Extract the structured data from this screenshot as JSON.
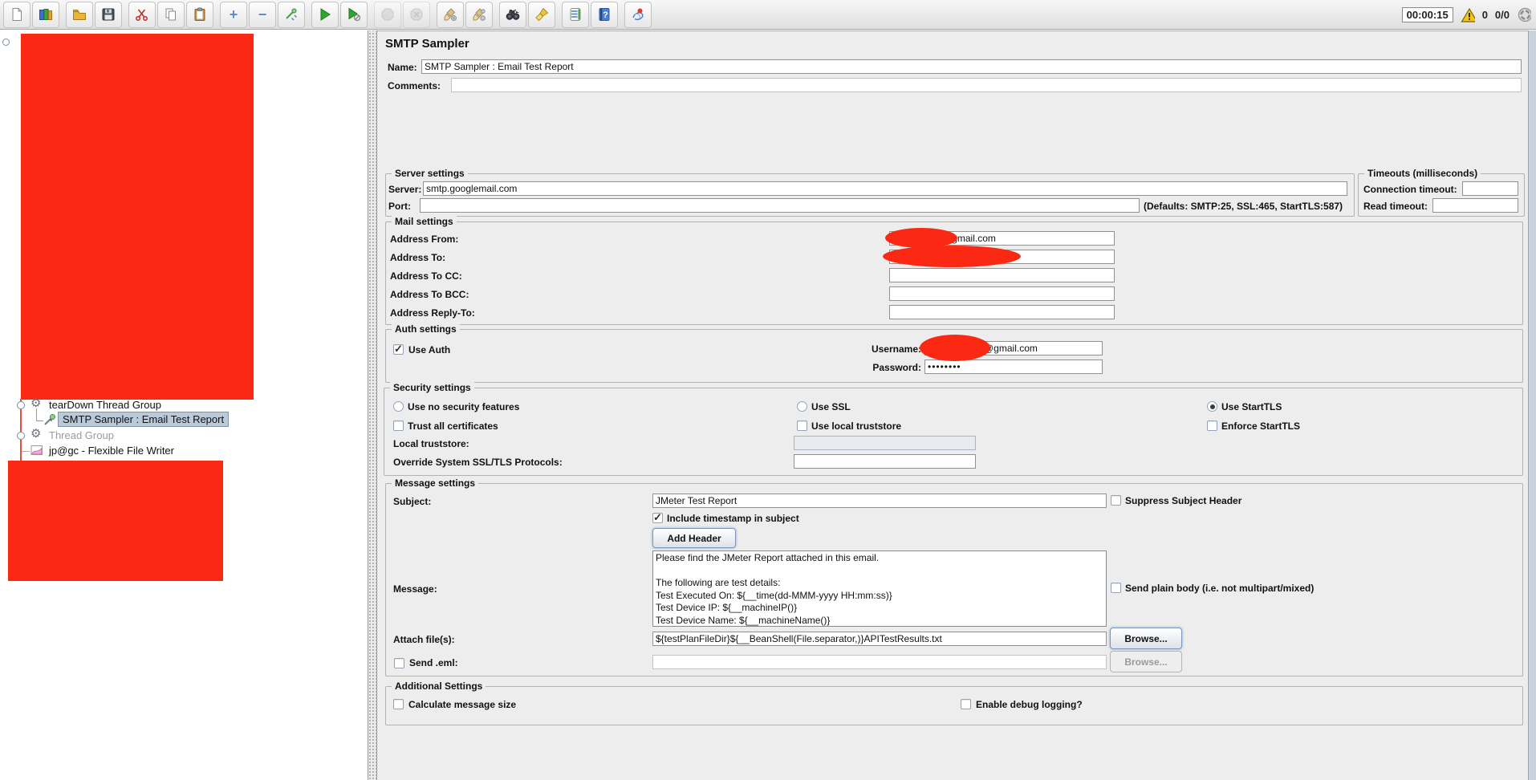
{
  "toolbar": {
    "icons": [
      "new-file",
      "templates",
      "open-file",
      "save",
      "cut",
      "copy",
      "paste",
      "expand-all",
      "collapse-all",
      "toggle",
      "start",
      "start-no-pauses",
      "stop",
      "shutdown",
      "clear",
      "clear-all",
      "search",
      "search-reset",
      "function-helper",
      "help",
      "plugins-manager"
    ],
    "timer": "00:00:15",
    "error_count": "0",
    "thread_status": "0/0"
  },
  "tree": {
    "items": [
      {
        "label": "tearDown Thread Group",
        "type": "thread-group",
        "state": "expanded",
        "selected": false,
        "disabled": false
      },
      {
        "label": "SMTP Sampler : Email Test Report",
        "type": "smtp-sampler",
        "selected": true,
        "disabled": false
      },
      {
        "label": "Thread Group",
        "type": "thread-group",
        "state": "collapsed",
        "selected": false,
        "disabled": true
      },
      {
        "label": "jp@gc - Flexible File Writer",
        "type": "flexible-file-writer",
        "selected": false,
        "disabled": false
      }
    ]
  },
  "main": {
    "title": "SMTP Sampler",
    "name": {
      "label": "Name:",
      "value": "SMTP Sampler : Email Test Report"
    },
    "comments": {
      "label": "Comments:",
      "value": ""
    },
    "server_settings": {
      "legend": "Server settings",
      "server_label": "Server:",
      "server_value": "smtp.googlemail.com",
      "port_label": "Port:",
      "port_value": "",
      "port_defaults": "(Defaults: SMTP:25, SSL:465, StartTLS:587)"
    },
    "timeouts": {
      "legend": "Timeouts (milliseconds)",
      "connection_label": "Connection timeout:",
      "connection_value": "",
      "read_label": "Read timeout:",
      "read_value": ""
    },
    "mail_settings": {
      "legend": "Mail settings",
      "address_from_label": "Address From:",
      "address_from_value": "@gmail.com",
      "address_to_label": "Address To:",
      "address_to_value": "",
      "address_cc_label": "Address To CC:",
      "address_cc_value": "",
      "address_bcc_label": "Address To BCC:",
      "address_bcc_value": "",
      "address_reply_label": "Address Reply-To:",
      "address_reply_value": ""
    },
    "auth_settings": {
      "legend": "Auth settings",
      "use_auth_label": "Use Auth",
      "use_auth_checked": true,
      "username_label": "Username:",
      "username_value": "@gmail.com",
      "password_label": "Password:",
      "password_value": "••••••••"
    },
    "security_settings": {
      "legend": "Security settings",
      "no_security_label": "Use no security features",
      "use_ssl_label": "Use SSL",
      "use_starttls_label": "Use StartTLS",
      "selected_option": "Use StartTLS",
      "trust_all_label": "Trust all certificates",
      "use_local_truststore_label": "Use local truststore",
      "enforce_starttls_label": "Enforce StartTLS",
      "local_truststore_label": "Local truststore:",
      "local_truststore_value": "",
      "override_label": "Override System SSL/TLS Protocols:",
      "override_value": ""
    },
    "message_settings": {
      "legend": "Message settings",
      "subject_label": "Subject:",
      "subject_value": "JMeter Test Report",
      "suppress_subject_label": "Suppress Subject Header",
      "include_timestamp_label": "Include timestamp in subject",
      "include_timestamp_checked": true,
      "add_header_button": "Add Header",
      "message_label": "Message:",
      "message_value": "Please find the JMeter Report attached in this email.\n\nThe following are test details:\nTest Executed On: ${__time(dd-MMM-yyyy HH:mm:ss)}\nTest Device IP: ${__machineIP()}\nTest Device Name: ${__machineName()}",
      "send_plain_label": "Send plain body (i.e. not multipart/mixed)",
      "attach_label": "Attach file(s):",
      "attach_value": "${testPlanFileDir}${__BeanShell(File.separator,)}APITestResults.txt",
      "browse_button": "Browse...",
      "send_eml_label": "Send .eml:",
      "send_eml_value": "",
      "browse_eml_button": "Browse..."
    },
    "additional_settings": {
      "legend": "Additional Settings",
      "calc_size_label": "Calculate message size",
      "debug_label": "Enable debug logging?"
    }
  },
  "colors": {
    "redaction": "#fb2913",
    "selection_bg": "#b9cadb",
    "selection_border": "#8193a5",
    "warning_yellow": "#f5c518",
    "panel_bg": "#ededed"
  }
}
